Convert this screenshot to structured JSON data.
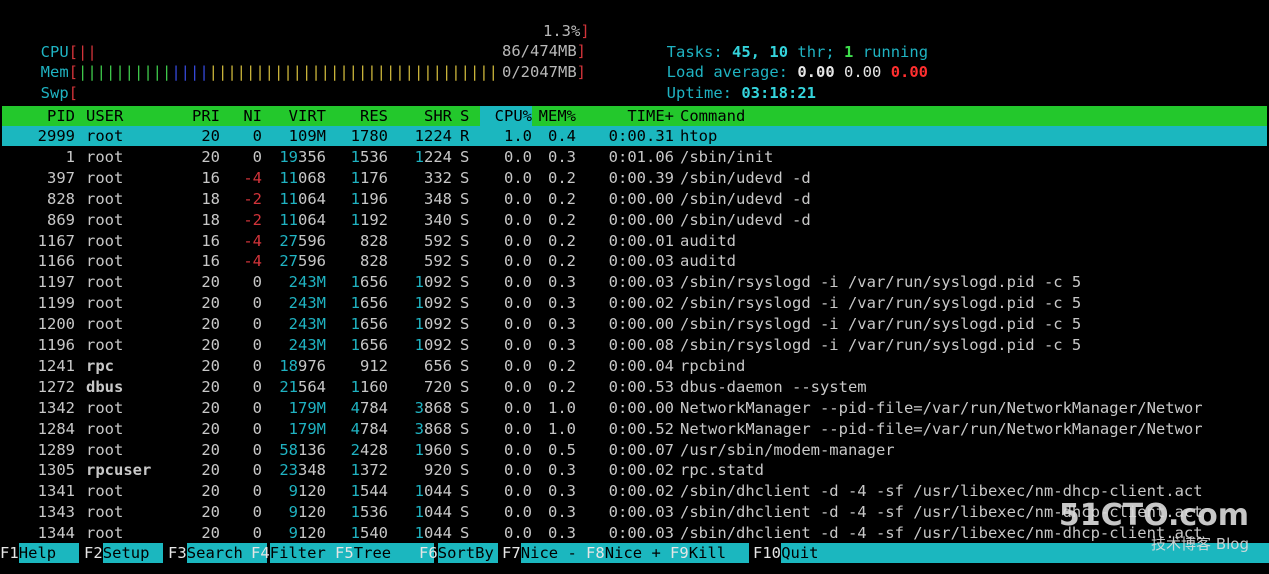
{
  "meters": {
    "cpu": {
      "label": "CPU",
      "value": "1.3%",
      "fraction": 0.013
    },
    "mem": {
      "label": "Mem",
      "value": "86/474MB",
      "fraction": 0.18
    },
    "swp": {
      "label": "Swp",
      "value": "0/2047MB",
      "fraction": 0.0
    }
  },
  "summary": {
    "tasks_label": "Tasks:",
    "tasks": "45,",
    "threads": "10",
    "thr_label": "thr;",
    "running": "1",
    "running_label": "running",
    "load_label": "Load average:",
    "load1": "0.00",
    "load5": "0.00",
    "load15": "0.00",
    "uptime_label": "Uptime:",
    "uptime": "03:18:21"
  },
  "columns": {
    "pid": "PID",
    "user": "USER",
    "pri": "PRI",
    "ni": "NI",
    "virt": "VIRT",
    "res": "RES",
    "shr": "SHR",
    "s": "S",
    "cpu": "CPU%",
    "mem": "MEM%",
    "time": "TIME+",
    "command": "Command"
  },
  "processes": [
    {
      "pid": "2999",
      "user": "root",
      "pri": "20",
      "ni": "0",
      "virt": "109M",
      "res": "1780",
      "shr": "1224",
      "s": "R",
      "cpu": "1.0",
      "mem": "0.4",
      "time": "0:00.31",
      "command": "htop"
    },
    {
      "pid": "1",
      "user": "root",
      "pri": "20",
      "ni": "0",
      "virt": "19356",
      "res": "1536",
      "shr": "1224",
      "s": "S",
      "cpu": "0.0",
      "mem": "0.3",
      "time": "0:01.06",
      "command": "/sbin/init"
    },
    {
      "pid": "397",
      "user": "root",
      "pri": "16",
      "ni": "-4",
      "virt": "11068",
      "res": "1176",
      "shr": "332",
      "s": "S",
      "cpu": "0.0",
      "mem": "0.2",
      "time": "0:00.39",
      "command": "/sbin/udevd -d"
    },
    {
      "pid": "828",
      "user": "root",
      "pri": "18",
      "ni": "-2",
      "virt": "11064",
      "res": "1196",
      "shr": "348",
      "s": "S",
      "cpu": "0.0",
      "mem": "0.2",
      "time": "0:00.00",
      "command": "/sbin/udevd -d"
    },
    {
      "pid": "869",
      "user": "root",
      "pri": "18",
      "ni": "-2",
      "virt": "11064",
      "res": "1192",
      "shr": "340",
      "s": "S",
      "cpu": "0.0",
      "mem": "0.2",
      "time": "0:00.00",
      "command": "/sbin/udevd -d"
    },
    {
      "pid": "1167",
      "user": "root",
      "pri": "16",
      "ni": "-4",
      "virt": "27596",
      "res": "828",
      "shr": "592",
      "s": "S",
      "cpu": "0.0",
      "mem": "0.2",
      "time": "0:00.01",
      "command": "auditd"
    },
    {
      "pid": "1166",
      "user": "root",
      "pri": "16",
      "ni": "-4",
      "virt": "27596",
      "res": "828",
      "shr": "592",
      "s": "S",
      "cpu": "0.0",
      "mem": "0.2",
      "time": "0:00.03",
      "command": "auditd"
    },
    {
      "pid": "1197",
      "user": "root",
      "pri": "20",
      "ni": "0",
      "virt": "243M",
      "res": "1656",
      "shr": "1092",
      "s": "S",
      "cpu": "0.0",
      "mem": "0.3",
      "time": "0:00.03",
      "command": "/sbin/rsyslogd -i /var/run/syslogd.pid -c 5"
    },
    {
      "pid": "1199",
      "user": "root",
      "pri": "20",
      "ni": "0",
      "virt": "243M",
      "res": "1656",
      "shr": "1092",
      "s": "S",
      "cpu": "0.0",
      "mem": "0.3",
      "time": "0:00.02",
      "command": "/sbin/rsyslogd -i /var/run/syslogd.pid -c 5"
    },
    {
      "pid": "1200",
      "user": "root",
      "pri": "20",
      "ni": "0",
      "virt": "243M",
      "res": "1656",
      "shr": "1092",
      "s": "S",
      "cpu": "0.0",
      "mem": "0.3",
      "time": "0:00.00",
      "command": "/sbin/rsyslogd -i /var/run/syslogd.pid -c 5"
    },
    {
      "pid": "1196",
      "user": "root",
      "pri": "20",
      "ni": "0",
      "virt": "243M",
      "res": "1656",
      "shr": "1092",
      "s": "S",
      "cpu": "0.0",
      "mem": "0.3",
      "time": "0:00.08",
      "command": "/sbin/rsyslogd -i /var/run/syslogd.pid -c 5"
    },
    {
      "pid": "1241",
      "user": "rpc",
      "pri": "20",
      "ni": "0",
      "virt": "18976",
      "res": "912",
      "shr": "656",
      "s": "S",
      "cpu": "0.0",
      "mem": "0.2",
      "time": "0:00.04",
      "command": "rpcbind"
    },
    {
      "pid": "1272",
      "user": "dbus",
      "pri": "20",
      "ni": "0",
      "virt": "21564",
      "res": "1160",
      "shr": "720",
      "s": "S",
      "cpu": "0.0",
      "mem": "0.2",
      "time": "0:00.53",
      "command": "dbus-daemon --system"
    },
    {
      "pid": "1342",
      "user": "root",
      "pri": "20",
      "ni": "0",
      "virt": "179M",
      "res": "4784",
      "shr": "3868",
      "s": "S",
      "cpu": "0.0",
      "mem": "1.0",
      "time": "0:00.00",
      "command": "NetworkManager --pid-file=/var/run/NetworkManager/Networ"
    },
    {
      "pid": "1284",
      "user": "root",
      "pri": "20",
      "ni": "0",
      "virt": "179M",
      "res": "4784",
      "shr": "3868",
      "s": "S",
      "cpu": "0.0",
      "mem": "1.0",
      "time": "0:00.52",
      "command": "NetworkManager --pid-file=/var/run/NetworkManager/Networ"
    },
    {
      "pid": "1289",
      "user": "root",
      "pri": "20",
      "ni": "0",
      "virt": "58136",
      "res": "2428",
      "shr": "1960",
      "s": "S",
      "cpu": "0.0",
      "mem": "0.5",
      "time": "0:00.07",
      "command": "/usr/sbin/modem-manager"
    },
    {
      "pid": "1305",
      "user": "rpcuser",
      "pri": "20",
      "ni": "0",
      "virt": "23348",
      "res": "1372",
      "shr": "920",
      "s": "S",
      "cpu": "0.0",
      "mem": "0.3",
      "time": "0:00.02",
      "command": "rpc.statd"
    },
    {
      "pid": "1341",
      "user": "root",
      "pri": "20",
      "ni": "0",
      "virt": "9120",
      "res": "1544",
      "shr": "1044",
      "s": "S",
      "cpu": "0.0",
      "mem": "0.3",
      "time": "0:00.02",
      "command": "/sbin/dhclient -d -4 -sf /usr/libexec/nm-dhcp-client.act"
    },
    {
      "pid": "1343",
      "user": "root",
      "pri": "20",
      "ni": "0",
      "virt": "9120",
      "res": "1536",
      "shr": "1044",
      "s": "S",
      "cpu": "0.0",
      "mem": "0.3",
      "time": "0:00.03",
      "command": "/sbin/dhclient -d -4 -sf /usr/libexec/nm-dhcp-client.act"
    },
    {
      "pid": "1344",
      "user": "root",
      "pri": "20",
      "ni": "0",
      "virt": "9120",
      "res": "1540",
      "shr": "1044",
      "s": "S",
      "cpu": "0.0",
      "mem": "0.3",
      "time": "0:00.03",
      "command": "/sbin/dhclient -d -4 -sf /usr/libexec/nm-dhcp-client.act"
    }
  ],
  "footer": [
    {
      "key": "F1",
      "label": "Help"
    },
    {
      "key": "F2",
      "label": "Setup"
    },
    {
      "key": "F3",
      "label": "Search"
    },
    {
      "key": "F4",
      "label": "Filter"
    },
    {
      "key": "F5",
      "label": "Tree"
    },
    {
      "key": "F6",
      "label": "SortBy"
    },
    {
      "key": "F7",
      "label": "Nice -"
    },
    {
      "key": "F8",
      "label": "Nice +"
    },
    {
      "key": "F9",
      "label": "Kill"
    },
    {
      "key": "F10",
      "label": "Quit"
    }
  ],
  "watermark": {
    "main": "51CTO.com",
    "sub": "技术博客",
    "blog": "Blog"
  },
  "colors": {
    "header_bg": "#23c82c",
    "selected_bg": "#1bb7bf",
    "cyan": "#1fb3c2",
    "red": "#d2343a",
    "green": "#3ec74a"
  }
}
